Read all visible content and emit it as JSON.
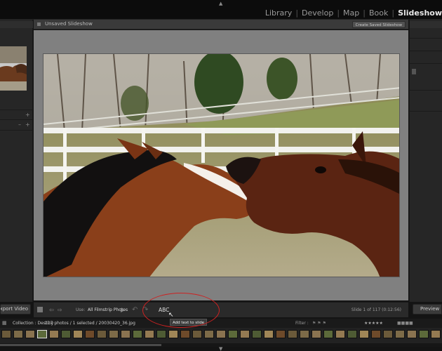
{
  "app": {
    "modules": [
      "Library",
      "Develop",
      "Map",
      "Book",
      "Slideshow"
    ],
    "active_module": "Slideshow"
  },
  "center": {
    "title": "Unsaved Slideshow",
    "create_saved_label": "Create Saved Slideshow"
  },
  "toolbar": {
    "use_label": "Use:",
    "use_value": "All Filmstrip Photos",
    "abc_label": "ABC",
    "tooltip": "Add text to slide",
    "slide_count": "Slide 1 of 117 (0:12:56)"
  },
  "left_bottom_button": "Export Video...",
  "right_bottom_button": "Preview",
  "filmstrip": {
    "collection": "Collection : Destiny",
    "photos_info": "117 photos / 1 selected / 20030420_36.jpg",
    "filter_label": "Filter :"
  },
  "colors": {
    "annotation": "#cc2222",
    "stage": "#808080"
  }
}
